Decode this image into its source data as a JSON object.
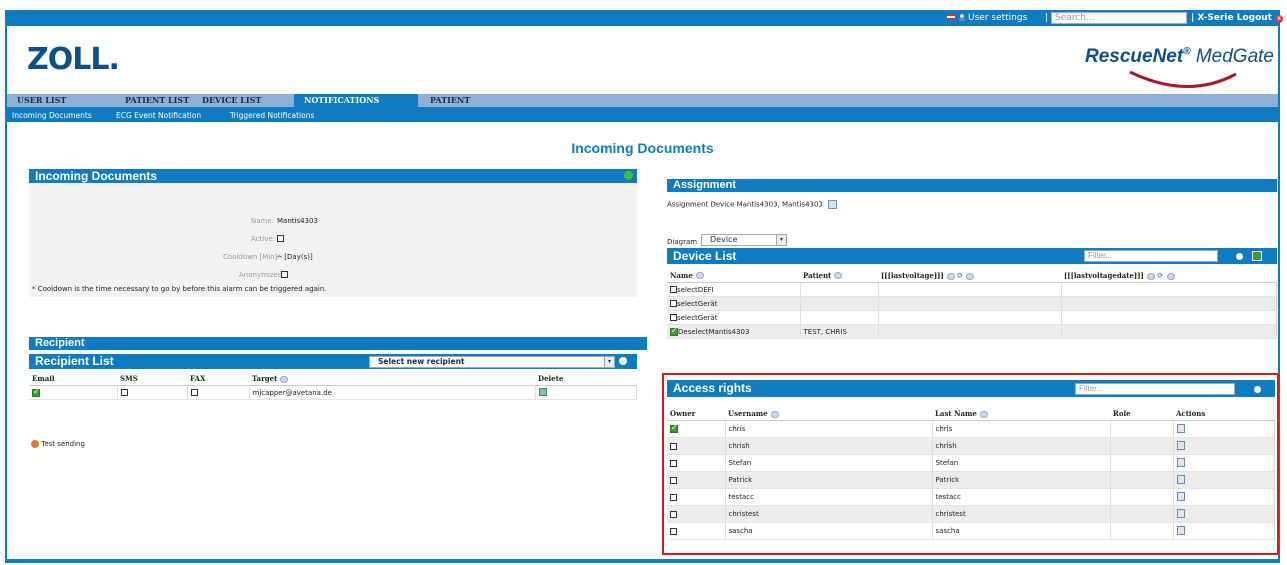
{
  "topbar": {
    "user_settings": "User settings",
    "search_placeholder": "Search...",
    "logout": "X-Serie Logout"
  },
  "header": {
    "logo_left": "ZOLL.",
    "logo_right_main": "RescueNet",
    "logo_right_reg": "®",
    "logo_right_sub": " MedGate"
  },
  "nav": {
    "tabs": [
      "USER LIST",
      "PATIENT LIST",
      "DEVICE LIST",
      "NOTIFICATIONS",
      "PATIENT"
    ],
    "active": "NOTIFICATIONS"
  },
  "subnav": [
    "Incoming Documents",
    "ECG Event Notification",
    "Triggered Notifications"
  ],
  "page_title": "Incoming Documents",
  "incoming": {
    "title": "Incoming Documents",
    "name_label": "Name:",
    "name_value": "Mantis4303",
    "active_label": "Active:",
    "cooldown_label": "Cooldown [Min]*:",
    "cooldown_value": "-- [Day(s)]",
    "anonymized_label": "Anonymized:",
    "note": "* Cooldown is the time necessary to go by before this alarm can be triggered again."
  },
  "recipient": {
    "section_title": "Recipient",
    "list_title": "Recipient List",
    "select_label": "Select new recipient",
    "columns": [
      "Email",
      "SMS",
      "FAX",
      "Target",
      "Delete"
    ],
    "rows": [
      {
        "email": true,
        "sms": false,
        "fax": false,
        "target": "mjcapper@avetana.de"
      }
    ],
    "test_sending": "Test sending"
  },
  "assignment": {
    "title": "Assignment",
    "text": "Assignment Device Mantis4303, Mantis4303",
    "diagram_label": "Diagram",
    "diagram_value": "Device"
  },
  "device_list": {
    "title": "Device List",
    "filter_placeholder": "Filter...",
    "columns": [
      "Name",
      "Patient",
      "[[[lastvoltage]]]",
      "[[[lastvoltagedate]]]"
    ],
    "rows": [
      {
        "checked": false,
        "name": "selectDEFI",
        "patient": ""
      },
      {
        "checked": false,
        "name": "selectGerät",
        "patient": ""
      },
      {
        "checked": false,
        "name": "selectGerät",
        "patient": ""
      },
      {
        "checked": true,
        "name": "DeselectMantis4303",
        "patient": "TEST, CHRIS"
      }
    ]
  },
  "access": {
    "title": "Access rights",
    "filter_placeholder": "Filter...",
    "columns": [
      "Owner",
      "Username",
      "Last Name",
      "Role",
      "Actions"
    ],
    "rows": [
      {
        "owner": true,
        "username": "chris",
        "lastname": "chris"
      },
      {
        "owner": false,
        "username": "chrish",
        "lastname": "chrish"
      },
      {
        "owner": false,
        "username": "Stefan",
        "lastname": "Stefan"
      },
      {
        "owner": false,
        "username": "Patrick",
        "lastname": "Patrick"
      },
      {
        "owner": false,
        "username": "testacc",
        "lastname": "testacc"
      },
      {
        "owner": false,
        "username": "christest",
        "lastname": "christest"
      },
      {
        "owner": false,
        "username": "sascha",
        "lastname": "sascha"
      }
    ]
  }
}
